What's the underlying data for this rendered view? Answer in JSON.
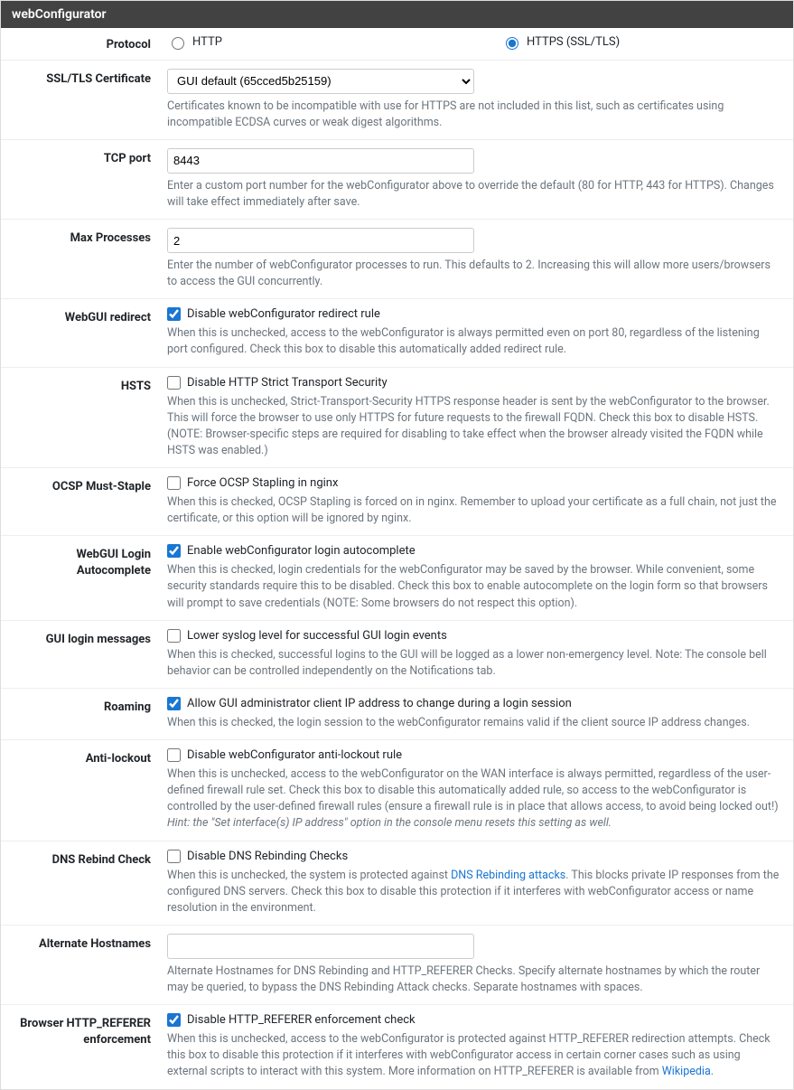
{
  "panel_title": "webConfigurator",
  "protocol": {
    "label": "Protocol",
    "http_label": "HTTP",
    "https_label": "HTTPS (SSL/TLS)",
    "selected": "https"
  },
  "ssl_cert": {
    "label": "SSL/TLS Certificate",
    "value": "GUI default (65cced5b25159)",
    "help": "Certificates known to be incompatible with use for HTTPS are not included in this list, such as certificates using incompatible ECDSA curves or weak digest algorithms."
  },
  "tcp_port": {
    "label": "TCP port",
    "value": "8443",
    "help": "Enter a custom port number for the webConfigurator above to override the default (80 for HTTP, 443 for HTTPS). Changes will take effect immediately after save."
  },
  "max_proc": {
    "label": "Max Processes",
    "value": "2",
    "help": "Enter the number of webConfigurator processes to run. This defaults to 2. Increasing this will allow more users/browsers to access the GUI concurrently."
  },
  "redirect": {
    "label": "WebGUI redirect",
    "checkbox_label": "Disable webConfigurator redirect rule",
    "checked": true,
    "help": "When this is unchecked, access to the webConfigurator is always permitted even on port 80, regardless of the listening port configured. Check this box to disable this automatically added redirect rule."
  },
  "hsts": {
    "label": "HSTS",
    "checkbox_label": "Disable HTTP Strict Transport Security",
    "checked": false,
    "help": "When this is unchecked, Strict-Transport-Security HTTPS response header is sent by the webConfigurator to the browser. This will force the browser to use only HTTPS for future requests to the firewall FQDN. Check this box to disable HSTS. (NOTE: Browser-specific steps are required for disabling to take effect when the browser already visited the FQDN while HSTS was enabled.)"
  },
  "ocsp": {
    "label": "OCSP Must-Staple",
    "checkbox_label": "Force OCSP Stapling in nginx",
    "checked": false,
    "help": "When this is checked, OCSP Stapling is forced on in nginx. Remember to upload your certificate as a full chain, not just the certificate, or this option will be ignored by nginx."
  },
  "autocomplete": {
    "label": "WebGUI Login Autocomplete",
    "checkbox_label": "Enable webConfigurator login autocomplete",
    "checked": true,
    "help": "When this is checked, login credentials for the webConfigurator may be saved by the browser. While convenient, some security standards require this to be disabled. Check this box to enable autocomplete on the login form so that browsers will prompt to save credentials (NOTE: Some browsers do not respect this option)."
  },
  "login_msg": {
    "label": "GUI login messages",
    "checkbox_label": "Lower syslog level for successful GUI login events",
    "checked": false,
    "help": "When this is checked, successful logins to the GUI will be logged as a lower non-emergency level. Note: The console bell behavior can be controlled independently on the Notifications tab."
  },
  "roaming": {
    "label": "Roaming",
    "checkbox_label": "Allow GUI administrator client IP address to change during a login session",
    "checked": true,
    "help": "When this is checked, the login session to the webConfigurator remains valid if the client source IP address changes."
  },
  "antilockout": {
    "label": "Anti-lockout",
    "checkbox_label": "Disable webConfigurator anti-lockout rule",
    "checked": false,
    "help_pre": "When this is unchecked, access to the webConfigurator on the WAN interface is always permitted, regardless of the user-defined firewall rule set. Check this box to disable this automatically added rule, so access to the webConfigurator is controlled by the user-defined firewall rules (ensure a firewall rule is in place that allows access, to avoid being locked out!) ",
    "help_hint": "Hint: the \"Set interface(s) IP address\" option in the console menu resets this setting as well."
  },
  "dns_rebind": {
    "label": "DNS Rebind Check",
    "checkbox_label": "Disable DNS Rebinding Checks",
    "checked": false,
    "help_pre": "When this is unchecked, the system is protected against ",
    "help_link": "DNS Rebinding attacks",
    "help_post": ". This blocks private IP responses from the configured DNS servers. Check this box to disable this protection if it interferes with webConfigurator access or name resolution in the environment."
  },
  "alt_host": {
    "label": "Alternate Hostnames",
    "value": "",
    "help": "Alternate Hostnames for DNS Rebinding and HTTP_REFERER Checks. Specify alternate hostnames by which the router may be queried, to bypass the DNS Rebinding Attack checks. Separate hostnames with spaces."
  },
  "referer": {
    "label": "Browser HTTP_REFERER enforcement",
    "checkbox_label": "Disable HTTP_REFERER enforcement check",
    "checked": true,
    "help_pre": "When this is unchecked, access to the webConfigurator is protected against HTTP_REFERER redirection attempts. Check this box to disable this protection if it interferes with webConfigurator access in certain corner cases such as using external scripts to interact with this system. More information on HTTP_REFERER is available from ",
    "help_link": "Wikipedia",
    "help_post": "."
  }
}
